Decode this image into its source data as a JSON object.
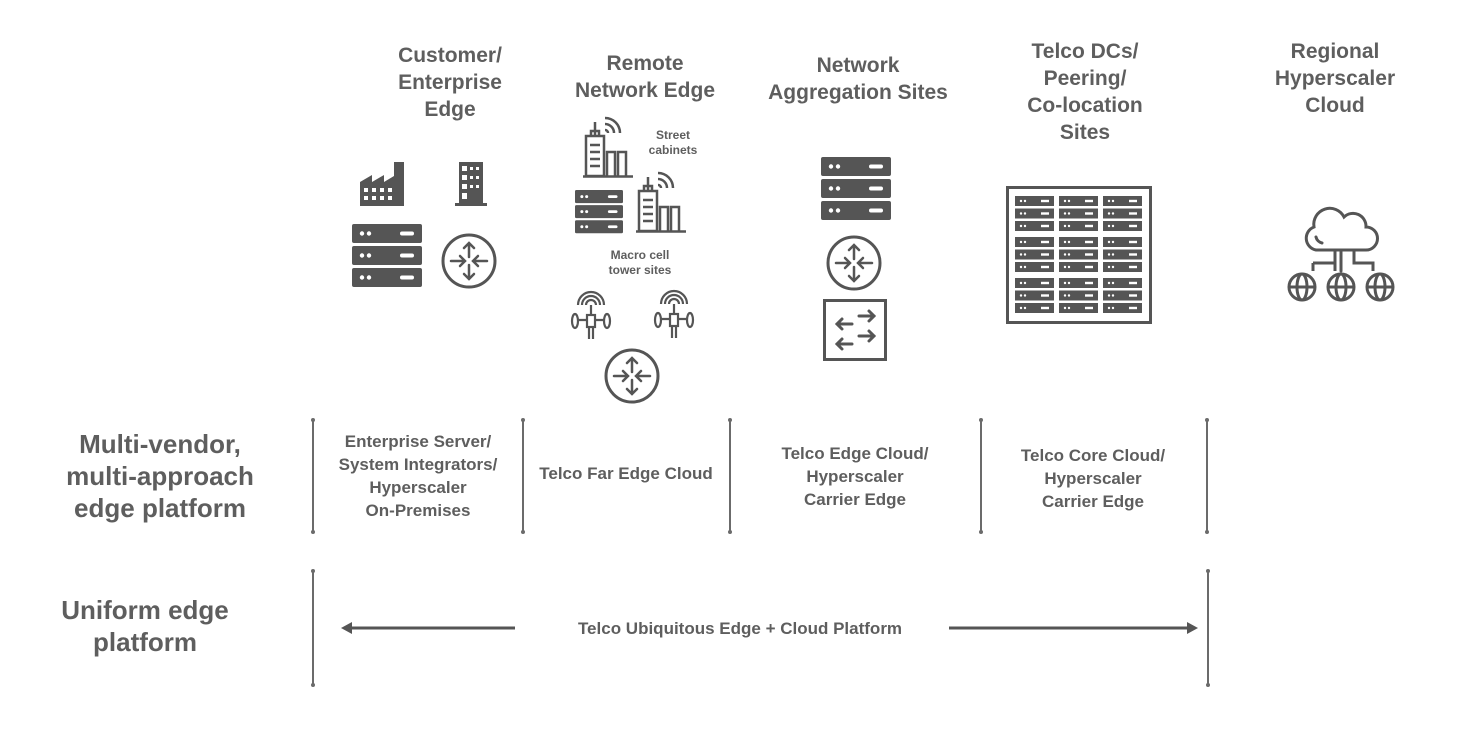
{
  "columns": [
    {
      "id": "customer",
      "title": "Customer/\nEnterprise\nEdge"
    },
    {
      "id": "remote",
      "title": "Remote\nNetwork Edge"
    },
    {
      "id": "aggregation",
      "title": "Network\nAggregation Sites"
    },
    {
      "id": "telco-dc",
      "title": "Telco DCs/\nPeering/\nCo-location\nSites"
    },
    {
      "id": "hyperscaler",
      "title": "Regional\nHyperscaler\nCloud"
    }
  ],
  "remote_labels": {
    "street": "Street\ncabinets",
    "macro": "Macro cell\ntower sites"
  },
  "rows": [
    {
      "label": "Multi-vendor,\nmulti-approach\nedge platform",
      "cells": [
        "Enterprise Server/\nSystem Integrators/\nHyperscaler\nOn-Premises",
        "Telco Far Edge Cloud",
        "Telco Edge Cloud/\nHyperscaler\nCarrier Edge",
        "Telco Core Cloud/\nHyperscaler\nCarrier Edge"
      ]
    },
    {
      "label": "Uniform edge\nplatform",
      "span_label": "Telco Ubiquitous Edge + Cloud Platform"
    }
  ],
  "colors": {
    "icon": "#555555",
    "text": "#5e5e5e",
    "line": "#6b6b6b"
  }
}
